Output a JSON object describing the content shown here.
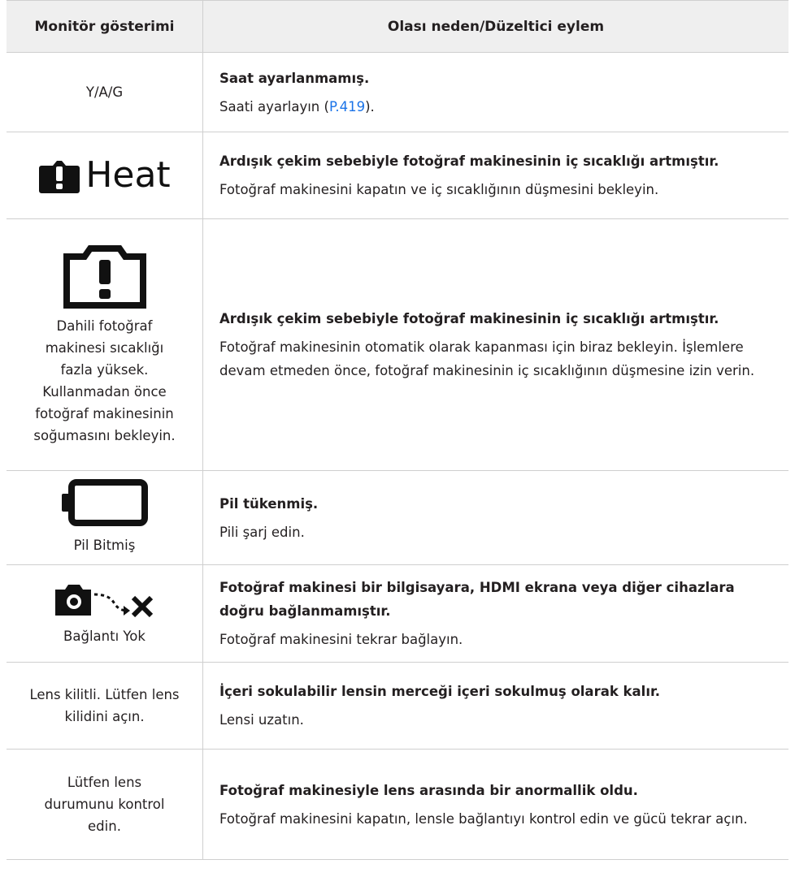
{
  "header": {
    "col1": "Monitör gösterimi",
    "col2": "Olası neden/Düzeltici eylem"
  },
  "rows": [
    {
      "monitor_text": "Y/A/G",
      "cause": "Saat ayarlanmamış.",
      "action_prefix": "Saati ayarlayın (",
      "action_link": "P.419",
      "action_suffix": ")."
    },
    {
      "icon": "warning-heat-icon",
      "icon_text": "Heat",
      "cause": "Ardışık çekim sebebiyle fotoğraf makinesinin iç sıcaklığı artmıştır.",
      "action": "Fotoğraf makinesini kapatın ve iç sıcaklığının düşmesini bekleyin."
    },
    {
      "icon": "camera-warning-icon",
      "monitor_text": "Dahili fotoğraf makinesi sıcaklığı fazla yüksek. Kullanmadan önce fotoğraf makinesinin soğumasını bekleyin.",
      "cause": "Ardışık çekim sebebiyle fotoğraf makinesinin iç sıcaklığı artmıştır.",
      "action": "Fotoğraf makinesinin otomatik olarak kapanması için biraz bekleyin. İşlemlere devam etmeden önce, fotoğraf makinesinin iç sıcaklığının düşmesine izin verin."
    },
    {
      "icon": "empty-battery-icon",
      "monitor_text": "Pil Bitmiş",
      "cause": "Pil tükenmiş.",
      "action": "Pili şarj edin."
    },
    {
      "icon": "no-connection-icon",
      "monitor_text": "Bağlantı Yok",
      "cause": "Fotoğraf makinesi bir bilgisayara, HDMI ekrana veya diğer cihazlara doğru bağlanmamıştır.",
      "action": "Fotoğraf makinesini tekrar bağlayın."
    },
    {
      "monitor_text": "Lens kilitli. Lütfen lens kilidini açın.",
      "cause": "İçeri sokulabilir lensin merceği içeri sokulmuş olarak kalır.",
      "action": "Lensi uzatın."
    },
    {
      "monitor_text": "Lütfen lens durumunu kontrol edin.",
      "cause": "Fotoğraf makinesiyle lens arasında bir anormallik oldu.",
      "action": "Fotoğraf makinesini kapatın, lensle bağlantıyı kontrol edin ve gücü tekrar açın."
    }
  ]
}
